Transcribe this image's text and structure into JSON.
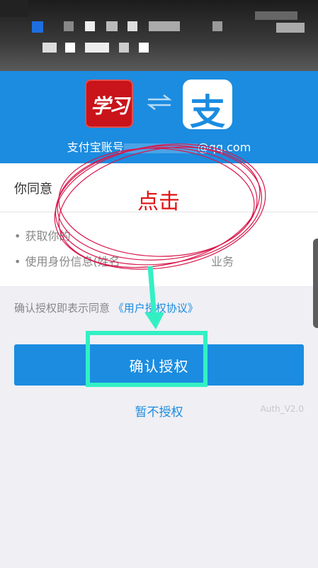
{
  "header": {
    "logo_left_text": "学习",
    "logo_right_text": "支",
    "account_prefix": "支付宝账号",
    "account_suffix": "@qq.com"
  },
  "agree_label": "你同意",
  "permissions": [
    {
      "text": "获取你的"
    },
    {
      "text": "使用身份信息(姓名",
      "tail": "业务"
    }
  ],
  "consent": {
    "prefix": "确认授权即表示同意",
    "link": "《用户授权协议》"
  },
  "confirm_button": "确认授权",
  "cancel_link": "暂不授权",
  "version": "Auth_V2.0",
  "annotation": {
    "text": "点击"
  },
  "colors": {
    "brand_blue": "#1b8ce0",
    "annotation_red": "#e01414",
    "highlight_green": "#33f0c4"
  }
}
